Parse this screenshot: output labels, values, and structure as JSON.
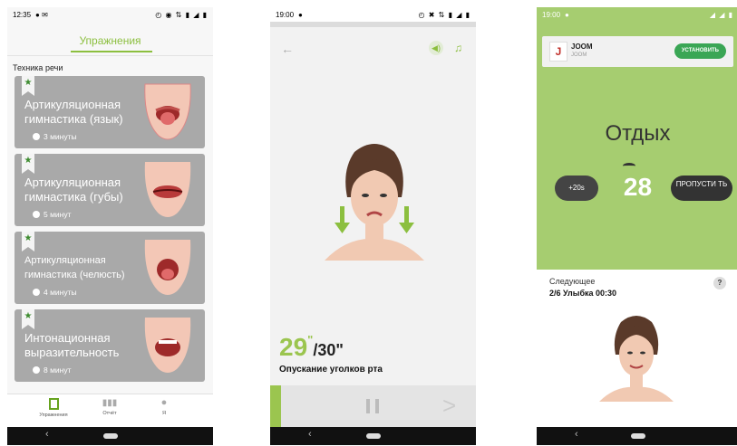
{
  "phone1": {
    "status": {
      "time": "12:35",
      "left_icons": "● ✉",
      "right_icons": "◴ ◉ ⇅ ▮ ◢ ▮"
    },
    "title": "Упражнения",
    "section": "Техника речи",
    "cards": [
      {
        "title": "Артикуляционная гимнастика (язык)",
        "duration": "3 минуты"
      },
      {
        "title": "Артикуляционная гимнастика (губы)",
        "duration": "5 минут"
      },
      {
        "title": "Артикуляционная гимнастика (челюсть)",
        "duration": "4 минуты"
      },
      {
        "title": "Интонационная выразительность",
        "duration": "8 минут"
      }
    ],
    "tabs": [
      {
        "label": "Упражнения",
        "icon": "exercise-icon"
      },
      {
        "label": "Отчёт",
        "icon": "chart-icon"
      },
      {
        "label": "Я",
        "icon": "person-icon"
      }
    ],
    "nav": {
      "back": "‹"
    }
  },
  "phone2": {
    "status": {
      "time": "19:00",
      "left_icons": "●",
      "right_icons": "◴ ✖ ⇅ ▮ ◢ ▮"
    },
    "back_glyph": "←",
    "sound_glyph": "◀)",
    "music_glyph": "♫",
    "timer": {
      "current": "29",
      "current_unit": "\"",
      "total": "/30\""
    },
    "exercise_name": "Опускание уголков рта",
    "next_glyph": ">",
    "nav": {
      "back": "‹"
    }
  },
  "phone3": {
    "status": {
      "time": "19:00",
      "left_icons": "●",
      "right_icons": "◢ ◢ ▮"
    },
    "ad": {
      "logo": "J",
      "name": "JOOM",
      "sub": "JOOM",
      "button": "УСТАНОВИТЬ"
    },
    "rest_title": "Отдых",
    "plus_button": "+20s",
    "countdown": "28",
    "skip_button": "ПРОПУСТИ ТЬ",
    "next_header": "Следующее",
    "next_exercise": "2/6 Улыбка 00:30",
    "help": "?",
    "nav": {
      "back": "‹"
    }
  },
  "colors": {
    "accent": "#8cbf3f",
    "rest_bg": "#a6cd70",
    "card_bg": "#a9a9a9",
    "install_btn": "#3aa655"
  }
}
